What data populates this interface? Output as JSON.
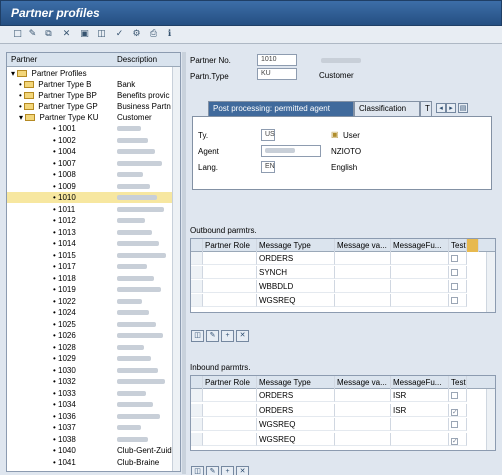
{
  "window": {
    "title": "Partner profiles"
  },
  "toolbar_icons": [
    "new-icon",
    "edit-icon",
    "copy-icon",
    "delete-icon",
    "save-icon",
    "display-icon",
    "check-icon",
    "config-icon",
    "print-icon"
  ],
  "tree": {
    "headers": {
      "partner": "Partner",
      "description": "Description"
    },
    "root": "Partner Profiles",
    "types": [
      {
        "label": "Partner Type B",
        "desc": "Bank"
      },
      {
        "label": "Partner Type BP",
        "desc": "Benefits provic"
      },
      {
        "label": "Partner Type GP",
        "desc": "Business Partn"
      },
      {
        "label": "Partner Type KU",
        "desc": "Customer"
      }
    ],
    "partners": [
      "1001",
      "1002",
      "1004",
      "1007",
      "1008",
      "1009",
      "1010",
      "1011",
      "1012",
      "1013",
      "1014",
      "1015",
      "1017",
      "1018",
      "1019",
      "1022",
      "1024",
      "1025",
      "1026",
      "1028",
      "1029",
      "1030",
      "1032",
      "1033",
      "1034",
      "1036",
      "1037",
      "1038",
      "1040",
      "1041"
    ],
    "partner_descs": {
      "1040": "Club-Gent-Zuid",
      "1041": "Club-Braine"
    },
    "selected": "1010"
  },
  "header": {
    "partner_no_label": "Partner No.",
    "partner_no_value": "1010",
    "partn_type_label": "Partn.Type",
    "partn_type_value": "KU",
    "partn_type_desc": "Customer"
  },
  "tabs": [
    {
      "label": "Post processing: permitted agent",
      "active": true
    },
    {
      "label": "Classification",
      "active": false
    },
    {
      "label": "T",
      "active": false
    }
  ],
  "agent_tab": {
    "ty_label": "Ty.",
    "ty_value": "US",
    "ty_desc": "User",
    "agent_label": "Agent",
    "agent_desc": "NZIOTO",
    "lang_label": "Lang.",
    "lang_value": "EN",
    "lang_desc": "English"
  },
  "outbound": {
    "title": "Outbound parmtrs.",
    "columns": [
      "Partner Role",
      "Message Type",
      "Message va...",
      "MessageFu...",
      "Test"
    ],
    "rows": [
      {
        "type": "ORDERS",
        "test": false
      },
      {
        "type": "SYNCH",
        "test": false
      },
      {
        "type": "WBBDLD",
        "test": false
      },
      {
        "type": "WGSREQ",
        "test": false
      }
    ]
  },
  "inbound": {
    "title": "Inbound parmtrs.",
    "columns": [
      "Partner Role",
      "Message Type",
      "Message va...",
      "MessageFu...",
      "Test"
    ],
    "rows": [
      {
        "type": "ORDERS",
        "func": "ISR",
        "test": false
      },
      {
        "type": "ORDERS",
        "func": "ISR",
        "test": true
      },
      {
        "type": "WGSREQ",
        "func": "",
        "test": false
      },
      {
        "type": "WGSREQ",
        "func": "",
        "test": true
      }
    ]
  },
  "colors": {
    "title_bar": "#2f5f97",
    "selected_row": "#f7e7a0"
  }
}
